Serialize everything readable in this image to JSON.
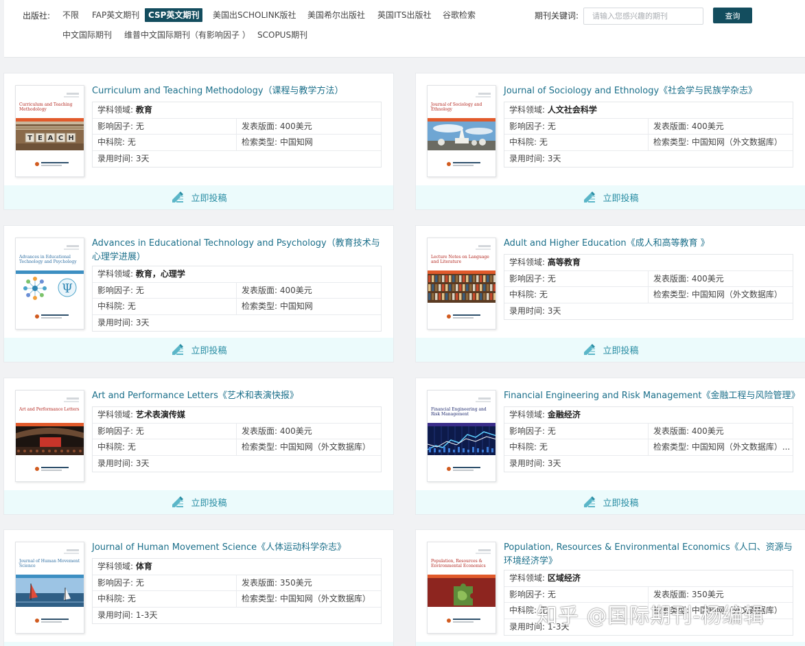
{
  "filter": {
    "publisher_label": "出版社:",
    "options": [
      {
        "label": "不限",
        "active": false
      },
      {
        "label": "FAP英文期刊",
        "active": false
      },
      {
        "label": "CSP英文期刊",
        "active": true
      },
      {
        "label": "美国出SCHOLINK版社",
        "active": false
      },
      {
        "label": "美国希尔出版社",
        "active": false
      },
      {
        "label": "英国ITS出版社",
        "active": false
      },
      {
        "label": "谷歌检索",
        "active": false
      },
      {
        "label": "中文国际期刊",
        "active": false
      },
      {
        "label": "维普中文国际期刊（有影响因子 ）",
        "active": false
      },
      {
        "label": "SCOPUS期刊",
        "active": false
      }
    ],
    "keyword_label": "期刊关键词:",
    "keyword_placeholder": "请输入您感兴趣的期刊",
    "search_button": "查询"
  },
  "labels": {
    "field": "学科领域: ",
    "impact": "影响因子: ",
    "fee": "发表版面: ",
    "cas": "中科院: ",
    "index": "检索类型: ",
    "time": "录用时间: ",
    "submit": "立即投稿"
  },
  "colors": {
    "accent": "#134d5e",
    "link": "#1b6f8a",
    "submit_bg": "#ecfbfc"
  },
  "journals": [
    {
      "title": "Curriculum and Teaching Methodology（课程与教学方法）",
      "cover_title": "Curriculum and Teaching Methodology",
      "cover_image": "teach-blocks",
      "field": "教育",
      "impact": "无",
      "fee": "400美元",
      "cas": "无",
      "index": "中国知网",
      "time": "3天"
    },
    {
      "title": "Journal of Sociology and Ethnology《社会学与民族学杂志》",
      "cover_title": "Journal of Sociology and Ethnology",
      "cover_image": "stupa-landscape",
      "field": "人文社会科学",
      "impact": "无",
      "fee": "400美元",
      "cas": "无",
      "index": "中国知网（外文数据库）",
      "time": "3天"
    },
    {
      "title": "Advances in Educational Technology and Psychology（教育技术与心理学进展）",
      "cover_title": "Advances in Educational Technology and Psychology",
      "cover_image": "psi-network",
      "field": "教育，心理学",
      "impact": "无",
      "fee": "400美元",
      "cas": "无",
      "index": "中国知网",
      "time": "3天"
    },
    {
      "title": "Adult and Higher Education《成人和高等教育 》",
      "cover_title": "Lecture Notes on Language and Literature",
      "cover_image": "library-shelves",
      "field": "高等教育",
      "impact": "无",
      "fee": "400美元",
      "cas": "无",
      "index": "中国知网（外文数据库）",
      "time": "3天"
    },
    {
      "title": "Art and Performance Letters《艺术和表演快报》",
      "cover_title": "Art and Performance Letters",
      "cover_image": "concert-hall",
      "field": "艺术表演传媒",
      "impact": "无",
      "fee": "400美元",
      "cas": "无",
      "index": "中国知网（外文数据库）",
      "time": "3天"
    },
    {
      "title": "Financial Engineering and Risk Management《金融工程与风险管理》",
      "cover_title": "Financial Engineering and Risk Management",
      "cover_image": "stock-chart",
      "field": "金融经济",
      "impact": "无",
      "fee": "400美元",
      "cas": "无",
      "index": "中国知网（外文数据库）...",
      "time": "3天"
    },
    {
      "title": "Journal of Human Movement Science《人体运动科学杂志》",
      "cover_title": "Journal of Human Movement Science",
      "cover_image": "windsurf-sea",
      "field": "体育",
      "impact": "无",
      "fee": "350美元",
      "cas": "无",
      "index": "中国知网（外文数据库）",
      "time": "1-3天"
    },
    {
      "title": "Population, Resources & Environmental Economics《人口、资源与环境经济学》",
      "cover_title": "Population, Resources & Environmental Economics",
      "cover_image": "puzzle-earth",
      "field": "区域经济",
      "impact": "无",
      "fee": "350美元",
      "cas": "无",
      "index": "中国知网（外文数据库）",
      "time": "1-3天"
    }
  ],
  "watermark": "知乎 @国际期刊-杨编辑"
}
